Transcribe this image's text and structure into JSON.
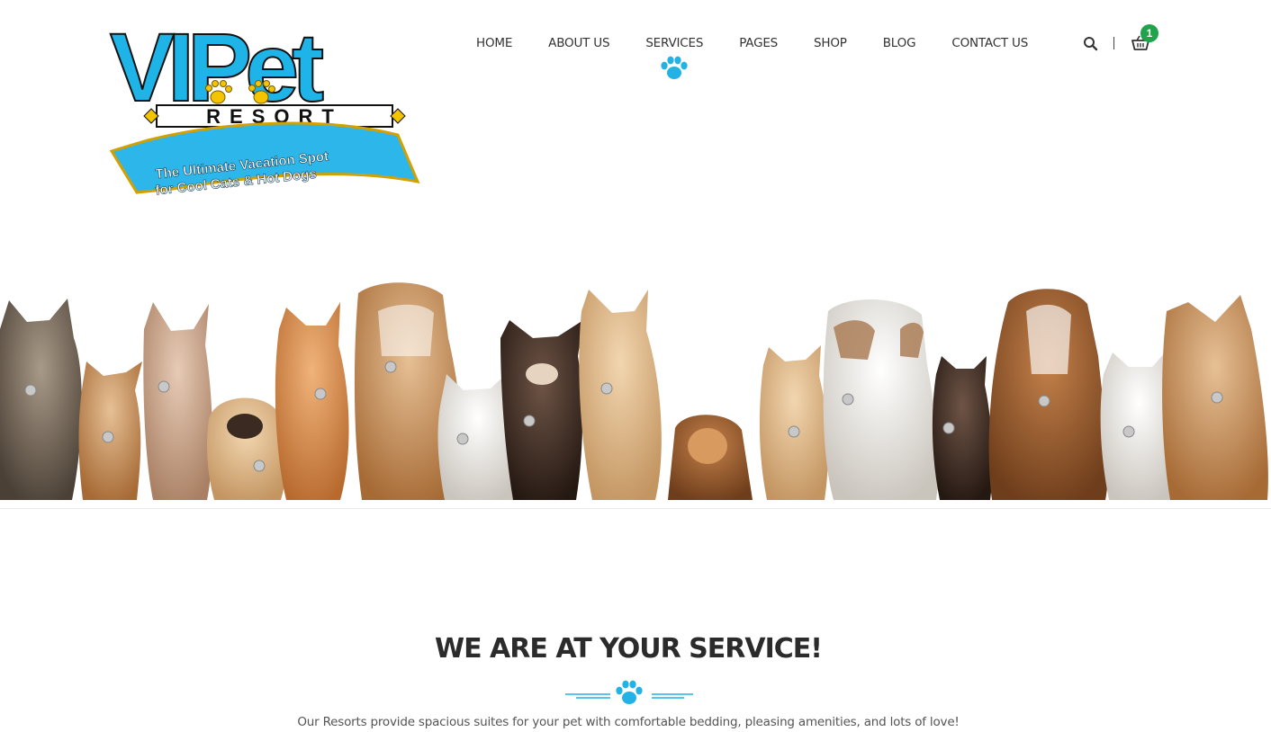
{
  "logo": {
    "brand_main": "VIPet",
    "brand_sub": "RESORT",
    "tagline_line1": "The Ultimate Vacation Spot",
    "tagline_line2": "for Cool Cats & Hot Dogs"
  },
  "nav": {
    "items": [
      {
        "label": "HOME"
      },
      {
        "label": "ABOUT US"
      },
      {
        "label": "SERVICES",
        "active": true
      },
      {
        "label": "PAGES"
      },
      {
        "label": "SHOP"
      },
      {
        "label": "BLOG"
      },
      {
        "label": "CONTACT US"
      }
    ],
    "cart_count": "1"
  },
  "section": {
    "title": "WE ARE AT YOUR SERVICE!",
    "text": "Our Resorts provide spacious suites for your pet with comfortable bedding, pleasing amenities, and lots of love!"
  },
  "colors": {
    "accent": "#22b2e6",
    "badge": "#20a34a",
    "text": "#333333"
  },
  "icons": {
    "search": "search-icon",
    "cart": "cart-icon",
    "paw": "paw-icon"
  }
}
